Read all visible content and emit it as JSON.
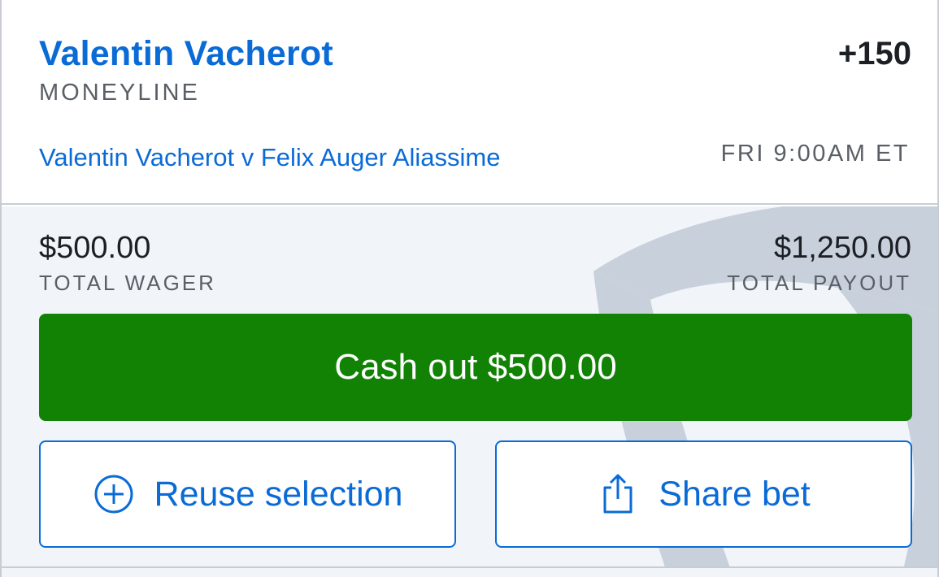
{
  "bet": {
    "selection": "Valentin Vacherot",
    "market": "MONEYLINE",
    "odds": "+150",
    "event": "Valentin Vacherot v Felix Auger Aliassime",
    "event_time": "FRI 9:00AM ET"
  },
  "summary": {
    "wager_amount": "$500.00",
    "wager_label": "TOTAL WAGER",
    "payout_amount": "$1,250.00",
    "payout_label": "TOTAL PAYOUT"
  },
  "actions": {
    "cashout_label": "Cash out $500.00",
    "reuse_label": "Reuse selection",
    "reuse_icon": "plus-circle-icon",
    "share_label": "Share bet",
    "share_icon": "share-icon"
  },
  "colors": {
    "link_blue": "#0a6bd6",
    "cashout_green": "#118203",
    "panel_bg": "#f1f5fa",
    "watermark_gray": "#c8d0db"
  }
}
